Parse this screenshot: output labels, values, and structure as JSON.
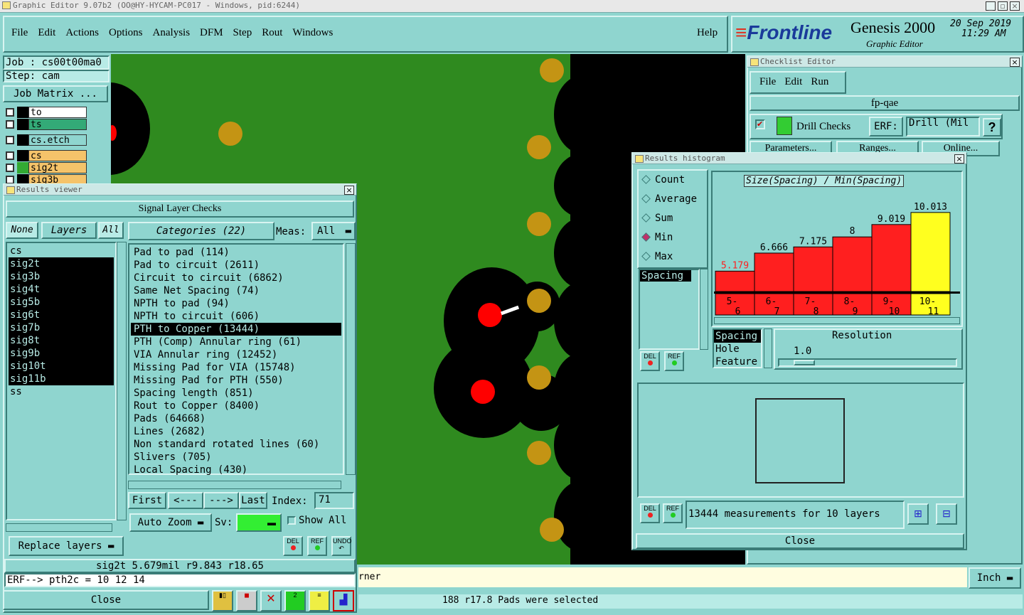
{
  "window_title": "Graphic Editor 9.07b2 (OO@HY-HYCAM-PC017 - Windows, pid:6244)",
  "menu": [
    "File",
    "Edit",
    "Actions",
    "Options",
    "Analysis",
    "DFM",
    "Step",
    "Rout",
    "Windows"
  ],
  "help": "Help",
  "brand": {
    "logo": "Frontline",
    "product": "Genesis 2000",
    "sub": "Graphic Editor",
    "date": "20 Sep 2019",
    "time": "11:29 AM"
  },
  "job": "Job : cs00t00ma0",
  "step": "Step: cam",
  "job_matrix": "Job Matrix ...",
  "layers_panel": [
    {
      "name": "to",
      "color": "#ffffff"
    },
    {
      "name": "ts",
      "color": "#33aa77"
    },
    {
      "name": "cs.etch",
      "color": "#8fd5cf"
    },
    {
      "name": "cs",
      "color": "#f5c36a"
    },
    {
      "name": "sig2t",
      "color": "#f5c36a"
    },
    {
      "name": "sig3b",
      "color": "#f5c36a"
    }
  ],
  "results_viewer": {
    "title": "Results viewer",
    "header": "Signal Layer Checks",
    "none": "None",
    "layers": "Layers",
    "all": "All",
    "categories_label": "Categories (22)",
    "meas_label": "Meas:",
    "meas_value": "All",
    "layer_list": [
      "cs",
      "sig2t",
      "sig3b",
      "sig4t",
      "sig5b",
      "sig6t",
      "sig7b",
      "sig8t",
      "sig9b",
      "sig10t",
      "sig11b",
      "ss"
    ],
    "selected_layers": [
      "sig2t",
      "sig3b",
      "sig4t",
      "sig5b",
      "sig6t",
      "sig7b",
      "sig8t",
      "sig9b",
      "sig10t",
      "sig11b"
    ],
    "categories": [
      "Pad to pad (114)",
      "Pad to circuit (2611)",
      "Circuit to circuit (6862)",
      "Same Net Spacing (74)",
      "NPTH to pad (94)",
      "NPTH to circuit (606)",
      "PTH to Copper (13444)",
      "PTH (Comp) Annular ring (61)",
      "VIA Annular ring (12452)",
      "Missing Pad for VIA (15748)",
      "Missing Pad for PTH (550)",
      "Spacing length (851)",
      "Rout to Copper (8400)",
      "Pads (64668)",
      "Lines (2682)",
      "Non standard rotated lines (60)",
      "Slivers (705)",
      "Local Spacing (430)"
    ],
    "selected_category": "PTH to Copper (13444)",
    "first": "First",
    "prev": "<---",
    "next": "--->",
    "last": "Last",
    "index_label": "Index:",
    "index_value": "71",
    "auto_zoom": "Auto Zoom",
    "sv": "Sv:",
    "show_all": "Show All",
    "replace_layers": "Replace layers",
    "del": "DEL",
    "ref": "REF",
    "undo": "UNDO",
    "status": "sig2t 5.679mil   r9.843   r18.65",
    "erf": "ERF--> pth2c = 10 12 14",
    "close": "Close"
  },
  "bottom_status": "188 r17.8 Pads were selected",
  "bottom_corner": "rner",
  "units": "Inch",
  "checklist": {
    "title": "Checklist Editor",
    "menu": [
      "File",
      "Edit",
      "Run"
    ],
    "name": "fp-qae",
    "check": "Drill Checks",
    "erf_label": "ERF:",
    "erf_value": "Drill (Mil",
    "parameters": "Parameters...",
    "ranges": "Ranges...",
    "online": "Online..."
  },
  "histogram": {
    "title": "Results histogram",
    "options": [
      "Count",
      "Average",
      "Sum",
      "Min",
      "Max"
    ],
    "selected_option": "Min",
    "list": [
      "Spacing"
    ],
    "chart_title": "Size(Spacing) / Min(Spacing)",
    "resolution_label": "Resolution",
    "resolution_value": "1.0",
    "attrs": [
      "Spacing",
      "Hole",
      "Feature"
    ],
    "summary": "13444 measurements for 10 layers",
    "close": "Close"
  },
  "chart_data": {
    "type": "bar",
    "title": "Size(Spacing) / Min(Spacing)",
    "categories": [
      "5-6",
      "6-7",
      "7-8",
      "8-9",
      "9-10",
      "10-11"
    ],
    "values": [
      5.179,
      6.666,
      7.175,
      8,
      9.019,
      10.013
    ],
    "value_labels": [
      "5.179",
      "6.666",
      "7.175",
      "8",
      "9.019",
      "10.013"
    ],
    "colors": [
      "#ff1f1f",
      "#ff1f1f",
      "#ff1f1f",
      "#ff1f1f",
      "#ff1f1f",
      "#ffff1f"
    ],
    "ylim": [
      0,
      11
    ]
  }
}
